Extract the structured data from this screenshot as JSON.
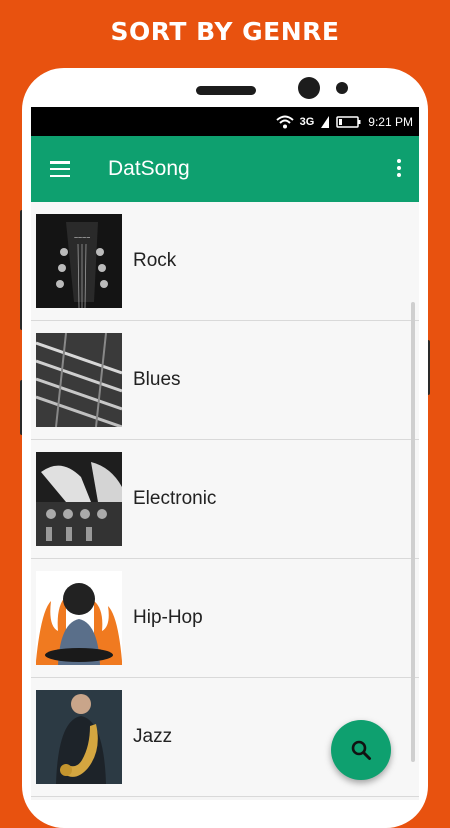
{
  "banner": {
    "text": "SORT BY GENRE"
  },
  "status_bar": {
    "network": "3G",
    "time": "9:21 PM"
  },
  "app_bar": {
    "title": "DatSong"
  },
  "genres": [
    {
      "label": "Rock"
    },
    {
      "label": "Blues"
    },
    {
      "label": "Electronic"
    },
    {
      "label": "Hip-Hop"
    },
    {
      "label": "Jazz"
    }
  ],
  "fab": {
    "icon": "search-icon"
  },
  "colors": {
    "accent": "#0ea06f",
    "background": "#e8520f"
  }
}
